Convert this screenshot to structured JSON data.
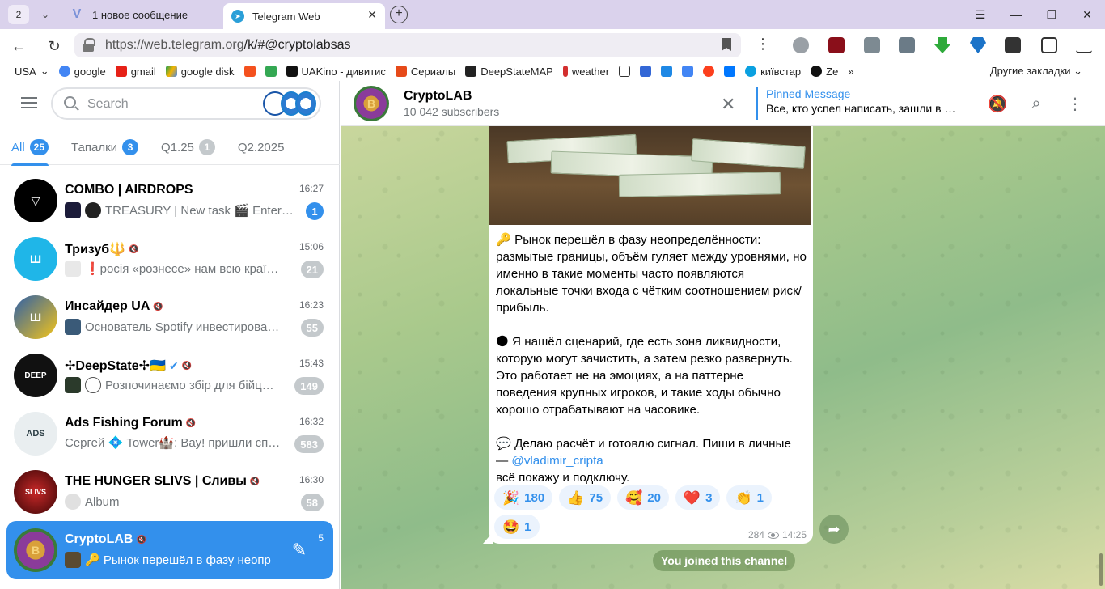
{
  "browser": {
    "tab_count": "2",
    "tabs": [
      {
        "title": "1 новое сообщение",
        "icon": "vk-icon"
      },
      {
        "title": "Telegram Web",
        "icon": "telegram-icon"
      }
    ],
    "url_host": "https://web.telegram.org",
    "url_path": "/k/#@cryptolabsas",
    "bookmarks": [
      "USA",
      "google",
      "gmail",
      "google disk",
      "",
      "",
      "UAKino - дивитис",
      "Сериалы",
      "DeepStateMAP",
      "weather",
      "",
      "",
      "",
      "",
      "",
      "",
      "київстар",
      "Ze"
    ],
    "bookmarks_more": "»",
    "other_bookmarks": "Другие закладки"
  },
  "sidebar": {
    "search_placeholder": "Search",
    "folders": [
      {
        "label": "All",
        "count": "25"
      },
      {
        "label": "Тапалки",
        "count": "3"
      },
      {
        "label": "Q1.25",
        "count": "1"
      },
      {
        "label": "Q2.2025",
        "count": ""
      }
    ],
    "chats": [
      {
        "title": "COMBO | AIRDROPS",
        "time": "16:27",
        "preview": "TREASURY | New task 🎬 Enter…",
        "unread": "1",
        "muted": false,
        "color": "#000000"
      },
      {
        "title": "Тризуб🔱",
        "time": "15:06",
        "preview": "❗росія «рознесе» нам всю краї…",
        "unread": "21",
        "muted": true,
        "color": "#1fb6e8"
      },
      {
        "title": "Инсайдер UA",
        "time": "16:23",
        "preview": "Основатель Spotify инвестирова…",
        "unread": "55",
        "muted": true,
        "color": "#2d5fa8"
      },
      {
        "title": "✢DeepState✢🇺🇦",
        "time": "15:43",
        "preview": "Розпочинаємо збір для бійц…",
        "unread": "149",
        "muted": true,
        "color": "#111111"
      },
      {
        "title": "Ads Fishing Forum",
        "time": "16:32",
        "preview": "Сергей 💠 Tower🏰: Вау! пришли сп…",
        "unread": "583",
        "muted": true,
        "color": "#3b4a4f"
      },
      {
        "title": "THE HUNGER SLIVS | Сливы",
        "time": "16:30",
        "preview": "Album",
        "unread": "58",
        "muted": true,
        "color": "#7a1010"
      },
      {
        "title": "CryptoLAB",
        "time": "5",
        "preview": "🔑 Рынок перешёл в фазу неопр",
        "unread": "",
        "muted": true,
        "color": "#8a3b9a"
      }
    ]
  },
  "chat": {
    "name": "CryptoLAB",
    "subscribers": "10 042 subscribers",
    "pinned_title": "Pinned Message",
    "pinned_text": "Все, кто успел написать, зашли в п…",
    "message": {
      "p1": "🔑 Рынок перешёл в фазу неопределённости: размытые границы, объём гуляет между уровнями, но именно в такие моменты часто появляются локальные точки входа с чётким соотношением риск/прибыль.",
      "p2": "🌑 Я нашёл сценарий, где есть зона ликвидности, которую могут зачистить, а затем резко развернуть. Это работает не на эмоциях, а на паттерне поведения крупных игроков, и такие ходы обычно хорошо отрабатывают на часовике.",
      "p3_a": "💬 Делаю расчёт и готовлю сигнал. Пиши в личные  —  ",
      "p3_link": "@vladimir_cripta",
      "p3_b": "всё покажу и подключу.",
      "views": "284",
      "time": "14:25"
    },
    "reactions": [
      {
        "emoji": "🎉",
        "count": "180"
      },
      {
        "emoji": "👍",
        "count": "75"
      },
      {
        "emoji": "🥰",
        "count": "20"
      },
      {
        "emoji": "❤️",
        "count": "3"
      },
      {
        "emoji": "👏",
        "count": "1"
      },
      {
        "emoji": "🤩",
        "count": "1"
      }
    ],
    "service_message": "You joined this channel"
  },
  "colors": {
    "accent": "#3390ec",
    "unread_muted": "#c4c9cc"
  }
}
